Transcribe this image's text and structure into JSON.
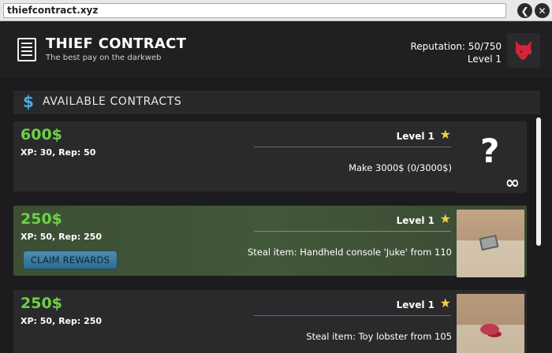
{
  "browser": {
    "url": "thiefcontract.xyz",
    "back_glyph": "❮",
    "close_glyph": "✕"
  },
  "app": {
    "title": "THIEF CONTRACT",
    "subtitle": "The best pay on the darkweb",
    "reputation": "Reputation: 50/750",
    "level": "Level 1",
    "doc_icon": "document-icon",
    "avatar_icon": "fox-avatar-icon"
  },
  "section": {
    "title": "AVAILABLE CONTRACTS",
    "icon": "dollar-icon",
    "icon_glyph": "$",
    "icon_color": "#4aa8e0"
  },
  "contracts": [
    {
      "reward": "600$",
      "xp_rep": "XP: 30, Rep: 50",
      "level": "Level 1",
      "description": "Make 3000$ (0/3000$)",
      "thumb": "unknown",
      "qmark": "?",
      "infinite": "∞"
    },
    {
      "reward": "250$",
      "xp_rep": "XP: 50, Rep: 250",
      "level": "Level 1",
      "description": "Steal item: Handheld console 'Juke' from 110",
      "thumb": "room-console",
      "claim_label": "CLAIM REWARDS"
    },
    {
      "reward": "250$",
      "xp_rep": "XP: 50, Rep: 250",
      "level": "Level 1",
      "description": "Steal item: Toy lobster from 105",
      "thumb": "room-lobster"
    }
  ],
  "colors": {
    "reward_green": "#6ed046",
    "star": "#f0d24a",
    "highlight_card": "#42583a",
    "button": "#3b7aa0"
  }
}
